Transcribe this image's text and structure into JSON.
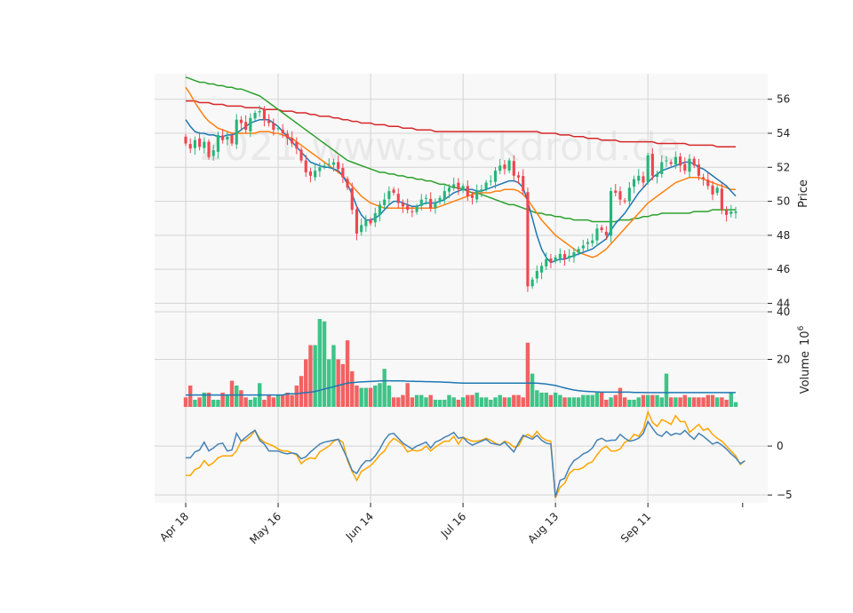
{
  "chart_data": {
    "type": "candlestick",
    "watermark": "2021 www.stockdroid.de",
    "colors": {
      "up": "#26b57a",
      "down": "#f0454f",
      "up_volume": "#3ec488",
      "down_volume": "#f26262",
      "ma_short": "#1f77b4",
      "ma_mid": "#ff7f0e",
      "ma_long": "#2ca02c",
      "ma_longest": "#d62728",
      "volume_ma": "#1f77b4",
      "macd": "#4682b4",
      "signal": "#ffa500",
      "panel_bg": "#f8f8f8",
      "grid": "#d4d4d4"
    },
    "x_tick_labels": [
      "Apr 18",
      "May 16",
      "Jun 14",
      "Jul 16",
      "Aug 13",
      "Sep 11"
    ],
    "x_tick_index": [
      0,
      20,
      40,
      60,
      80,
      100
    ],
    "n_bars": 120,
    "price": {
      "ylabel": "Price",
      "ylim": [
        43.5,
        57.5
      ],
      "yticks": [
        44,
        46,
        48,
        50,
        52,
        54,
        56
      ],
      "close": [
        53.4,
        53.1,
        53.6,
        53.2,
        53.5,
        52.6,
        53.0,
        53.9,
        53.6,
        53.8,
        53.4,
        54.8,
        54.6,
        54.2,
        54.9,
        55.2,
        55.3,
        54.8,
        54.6,
        54.2,
        54.3,
        54.0,
        53.7,
        53.4,
        53.1,
        52.4,
        51.7,
        51.5,
        51.8,
        52.0,
        52.1,
        52.2,
        52.3,
        51.9,
        51.4,
        50.8,
        49.5,
        48.1,
        48.6,
        48.9,
        48.7,
        49.3,
        49.8,
        50.1,
        50.6,
        50.5,
        49.9,
        49.7,
        49.5,
        49.4,
        49.7,
        50.1,
        50.2,
        49.6,
        49.9,
        50.2,
        50.6,
        50.8,
        51.0,
        50.7,
        50.9,
        50.3,
        50.2,
        50.6,
        50.7,
        51.1,
        51.2,
        51.8,
        52.1,
        51.9,
        52.4,
        51.5,
        51.4,
        50.6,
        45.0,
        45.4,
        45.9,
        46.2,
        46.6,
        46.4,
        46.7,
        46.9,
        46.6,
        46.8,
        47.0,
        47.2,
        47.4,
        47.6,
        47.7,
        48.4,
        48.3,
        48.0,
        50.6,
        50.5,
        50.1,
        50.0,
        50.8,
        51.3,
        51.5,
        51.1,
        52.7,
        51.5,
        51.6,
        52.3,
        52.4,
        52.2,
        52.6,
        52.1,
        51.8,
        52.5,
        52.1,
        51.5,
        51.3,
        50.9,
        50.4,
        50.8,
        49.5,
        49.2,
        49.4,
        49.4
      ],
      "ma_short": [
        54.8,
        54.4,
        54.1,
        54.0,
        54.0,
        53.9,
        53.9,
        53.8,
        53.8,
        53.9,
        53.9,
        54.0,
        54.2,
        54.4,
        54.6,
        54.7,
        54.8,
        54.8,
        54.8,
        54.6,
        54.4,
        54.1,
        53.8,
        53.5,
        53.2,
        52.9,
        52.6,
        52.3,
        52.2,
        52.1,
        52.0,
        52.0,
        51.9,
        51.8,
        51.5,
        51.0,
        50.4,
        49.7,
        49.2,
        48.9,
        48.9,
        49.0,
        49.2,
        49.5,
        49.8,
        50.0,
        50.0,
        49.9,
        49.8,
        49.7,
        49.7,
        49.8,
        49.9,
        49.9,
        49.9,
        50.0,
        50.1,
        50.3,
        50.5,
        50.6,
        50.7,
        50.7,
        50.7,
        50.6,
        50.6,
        50.7,
        50.8,
        50.9,
        51.0,
        51.1,
        51.2,
        51.2,
        51.1,
        50.8,
        50.0,
        49.0,
        48.0,
        47.2,
        46.7,
        46.4,
        46.5,
        46.6,
        46.6,
        46.7,
        46.8,
        46.9,
        47.0,
        47.1,
        47.2,
        47.4,
        47.6,
        47.8,
        48.3,
        48.7,
        49.0,
        49.3,
        49.7,
        50.1,
        50.5,
        50.8,
        51.1,
        51.4,
        51.6,
        51.8,
        51.9,
        52.0,
        52.1,
        52.2,
        52.3,
        52.3,
        52.2,
        52.0,
        51.9,
        51.7,
        51.5,
        51.3,
        51.1,
        50.9,
        50.6,
        50.3
      ],
      "ma_mid": [
        56.7,
        56.3,
        55.8,
        55.4,
        55.0,
        54.7,
        54.5,
        54.3,
        54.2,
        54.1,
        54.0,
        54.0,
        54.0,
        54.0,
        54.0,
        54.0,
        54.1,
        54.1,
        54.1,
        54.0,
        54.0,
        53.9,
        53.8,
        53.7,
        53.5,
        53.3,
        53.1,
        52.9,
        52.7,
        52.5,
        52.3,
        52.1,
        51.9,
        51.7,
        51.5,
        51.2,
        50.9,
        50.6,
        50.3,
        50.1,
        49.9,
        49.8,
        49.7,
        49.6,
        49.6,
        49.6,
        49.6,
        49.6,
        49.6,
        49.6,
        49.6,
        49.6,
        49.6,
        49.6,
        49.6,
        49.7,
        49.8,
        49.9,
        50.0,
        50.1,
        50.2,
        50.3,
        50.4,
        50.5,
        50.5,
        50.5,
        50.5,
        50.6,
        50.6,
        50.7,
        50.7,
        50.7,
        50.6,
        50.4,
        50.1,
        49.7,
        49.3,
        48.9,
        48.6,
        48.3,
        48.0,
        47.8,
        47.6,
        47.4,
        47.2,
        47.0,
        46.9,
        46.8,
        46.7,
        46.8,
        47.0,
        47.2,
        47.5,
        47.8,
        48.1,
        48.4,
        48.7,
        49.0,
        49.3,
        49.6,
        49.9,
        50.1,
        50.3,
        50.5,
        50.7,
        50.9,
        51.1,
        51.2,
        51.3,
        51.4,
        51.4,
        51.4,
        51.3,
        51.2,
        51.1,
        51.0,
        50.9,
        50.8,
        50.7,
        50.7
      ],
      "ma_long": [
        57.3,
        57.2,
        57.1,
        57.0,
        57.0,
        56.9,
        56.9,
        56.8,
        56.8,
        56.7,
        56.7,
        56.6,
        56.6,
        56.5,
        56.4,
        56.3,
        56.2,
        56.0,
        55.8,
        55.6,
        55.4,
        55.2,
        55.0,
        54.8,
        54.6,
        54.4,
        54.2,
        54.0,
        53.8,
        53.6,
        53.4,
        53.2,
        53.0,
        52.8,
        52.6,
        52.4,
        52.3,
        52.2,
        52.1,
        52.0,
        51.9,
        51.8,
        51.7,
        51.7,
        51.6,
        51.6,
        51.5,
        51.5,
        51.4,
        51.4,
        51.3,
        51.3,
        51.2,
        51.2,
        51.1,
        51.0,
        51.0,
        50.9,
        50.8,
        50.8,
        50.7,
        50.6,
        50.5,
        50.5,
        50.4,
        50.3,
        50.2,
        50.1,
        50.0,
        49.9,
        49.8,
        49.8,
        49.7,
        49.6,
        49.5,
        49.4,
        49.3,
        49.3,
        49.2,
        49.2,
        49.1,
        49.1,
        49.0,
        49.0,
        48.9,
        48.9,
        48.9,
        48.9,
        48.8,
        48.8,
        48.8,
        48.8,
        48.8,
        48.8,
        48.9,
        48.9,
        48.9,
        49.0,
        49.0,
        49.1,
        49.1,
        49.2,
        49.2,
        49.3,
        49.3,
        49.3,
        49.3,
        49.3,
        49.3,
        49.3,
        49.4,
        49.4,
        49.4,
        49.4,
        49.5,
        49.5,
        49.5,
        49.5,
        49.5,
        49.5
      ],
      "ma_longest": [
        55.9,
        55.9,
        55.9,
        55.8,
        55.8,
        55.8,
        55.7,
        55.7,
        55.7,
        55.6,
        55.6,
        55.6,
        55.6,
        55.5,
        55.5,
        55.5,
        55.5,
        55.4,
        55.4,
        55.4,
        55.4,
        55.3,
        55.3,
        55.3,
        55.2,
        55.2,
        55.2,
        55.1,
        55.1,
        55.0,
        55.0,
        55.0,
        54.9,
        54.9,
        54.8,
        54.8,
        54.7,
        54.7,
        54.6,
        54.6,
        54.6,
        54.5,
        54.5,
        54.5,
        54.4,
        54.4,
        54.4,
        54.3,
        54.3,
        54.3,
        54.2,
        54.2,
        54.2,
        54.2,
        54.1,
        54.1,
        54.1,
        54.1,
        54.1,
        54.1,
        54.1,
        54.1,
        54.1,
        54.1,
        54.1,
        54.1,
        54.1,
        54.1,
        54.1,
        54.1,
        54.1,
        54.1,
        54.1,
        54.1,
        54.1,
        54.1,
        54.1,
        54.0,
        54.0,
        54.0,
        54.0,
        53.9,
        53.9,
        53.9,
        53.8,
        53.8,
        53.8,
        53.7,
        53.7,
        53.7,
        53.6,
        53.6,
        53.6,
        53.6,
        53.5,
        53.5,
        53.5,
        53.5,
        53.5,
        53.5,
        53.5,
        53.5,
        53.4,
        53.4,
        53.4,
        53.4,
        53.4,
        53.4,
        53.4,
        53.3,
        53.3,
        53.3,
        53.3,
        53.3,
        53.3,
        53.2,
        53.2,
        53.2,
        53.2,
        53.2
      ]
    },
    "volume": {
      "ylabel": "Volume  10^6",
      "ylabel_text": "Volume",
      "ylabel_exp_base": "10",
      "ylabel_exp": "6",
      "ylim": [
        0,
        40
      ],
      "yticks": [
        20,
        40
      ],
      "values": [
        4,
        9,
        3,
        4,
        6,
        6,
        3,
        3,
        6,
        5,
        11,
        9,
        7,
        4,
        3,
        4,
        10,
        3,
        5,
        4,
        5,
        5,
        6,
        5,
        9,
        13,
        20,
        26,
        26,
        37,
        36,
        20,
        26,
        20,
        18,
        28,
        15,
        9,
        8,
        8,
        8,
        9,
        10,
        16,
        9,
        4,
        4,
        5,
        10,
        4,
        5,
        5,
        4,
        5,
        3,
        3,
        3,
        5,
        4,
        3,
        4,
        5,
        5,
        6,
        4,
        4,
        3,
        4,
        5,
        4,
        4,
        5,
        5,
        4,
        27,
        14,
        7,
        6,
        6,
        5,
        6,
        5,
        4,
        4,
        4,
        4,
        5,
        5,
        5,
        6,
        6,
        3,
        4,
        5,
        8,
        4,
        3,
        3,
        4,
        5,
        5,
        5,
        5,
        4,
        14,
        4,
        4,
        4,
        5,
        4,
        4,
        4,
        4,
        5,
        5,
        4,
        4,
        3,
        6,
        2
      ],
      "ma": [
        5,
        5,
        5,
        5,
        5,
        5,
        5,
        5,
        5,
        5,
        5,
        5,
        5,
        5,
        5,
        5,
        5,
        5,
        5,
        5,
        5,
        5,
        5.5,
        5.5,
        5.5,
        5.8,
        6.0,
        6.2,
        6.5,
        7.0,
        7.5,
        8.0,
        8.5,
        9.0,
        9.5,
        10.0,
        10.2,
        10.4,
        10.5,
        10.6,
        10.7,
        10.8,
        10.9,
        11.0,
        11.0,
        10.9,
        10.9,
        10.9,
        10.8,
        10.8,
        10.7,
        10.7,
        10.6,
        10.6,
        10.5,
        10.5,
        10.4,
        10.3,
        10.2,
        10.1,
        10.0,
        10.0,
        10.0,
        10.0,
        10.0,
        10.0,
        10.0,
        10.0,
        10.0,
        10.0,
        10.0,
        10.0,
        10.0,
        10.0,
        10.0,
        10.0,
        10.0,
        9.8,
        9.6,
        9.3,
        9.0,
        8.5,
        8.0,
        7.5,
        7.1,
        6.8,
        6.6,
        6.5,
        6.4,
        6.3,
        6.2,
        6.2,
        6.2,
        6.2,
        6.2,
        6.2,
        6.2,
        6.1,
        6.1,
        6.1,
        6.0,
        6.0,
        6.0,
        6.0,
        6.0,
        6.0,
        6.0,
        6.0,
        6.0,
        6.0,
        6.0,
        6.0,
        6.0,
        6.0,
        6.0,
        6.0,
        6.0,
        6.0,
        6.0,
        6.0
      ]
    },
    "macd": {
      "ylim": [
        -5.8,
        4.0
      ],
      "yticks": [
        -5,
        0
      ],
      "macd": [
        -1.2,
        -1.2,
        -0.6,
        -0.4,
        0.4,
        -0.5,
        -0.2,
        0.2,
        0.3,
        -0.5,
        -0.4,
        1.3,
        0.5,
        0.9,
        1.3,
        1.6,
        0.6,
        0.2,
        -0.5,
        -0.5,
        -0.5,
        -0.7,
        -0.8,
        -0.7,
        -0.8,
        -1.3,
        -1.1,
        -0.6,
        -0.2,
        0.2,
        0.4,
        0.5,
        0.6,
        0.7,
        -0.3,
        -1.3,
        -2.5,
        -2.8,
        -2.0,
        -1.5,
        -1.5,
        -1.0,
        -0.3,
        0.6,
        1.2,
        1.3,
        0.8,
        0.3,
        0.0,
        -0.3,
        0.0,
        0.2,
        0.4,
        -0.2,
        0.4,
        0.6,
        0.9,
        1.1,
        1.4,
        0.8,
        0.9,
        0.4,
        0.1,
        0.3,
        0.5,
        0.7,
        0.3,
        0.2,
        0.1,
        0.4,
        -0.1,
        -0.6,
        0.3,
        1.1,
        0.9,
        0.7,
        1.1,
        0.6,
        0.3,
        0.2,
        -5.2,
        -3.5,
        -3.3,
        -2.2,
        -1.5,
        -1.2,
        -0.8,
        -0.6,
        -0.2,
        0.6,
        0.8,
        0.5,
        0.6,
        0.6,
        1.2,
        0.8,
        0.5,
        0.6,
        0.8,
        1.3,
        2.5,
        1.8,
        1.2,
        1.0,
        1.5,
        1.1,
        1.3,
        1.2,
        1.6,
        1.1,
        0.7,
        1.3,
        1.0,
        0.6,
        0.2,
        0.4,
        0.1,
        -0.3,
        -0.8,
        -1.2,
        -1.8,
        -1.5
      ],
      "signal": [
        -3.0,
        -3.0,
        -2.4,
        -2.2,
        -1.5,
        -2.0,
        -1.7,
        -1.2,
        -1.0,
        -1.0,
        -1.0,
        -0.5,
        0.5,
        0.6,
        1.0,
        1.6,
        0.8,
        0.4,
        0.2,
        0.0,
        -0.3,
        -0.5,
        -0.5,
        -0.7,
        -0.9,
        -1.8,
        -1.4,
        -1.2,
        -1.3,
        -0.6,
        -0.3,
        0.0,
        0.5,
        0.7,
        0.4,
        -1.5,
        -2.6,
        -3.5,
        -2.6,
        -2.3,
        -2.0,
        -1.5,
        -0.9,
        -0.5,
        0.3,
        0.8,
        0.5,
        0.1,
        -0.6,
        -0.4,
        -0.5,
        -0.4,
        0.0,
        -0.5,
        -0.1,
        0.2,
        0.5,
        0.5,
        1.0,
        0.2,
        0.9,
        0.7,
        0.5,
        0.5,
        0.6,
        0.8,
        0.6,
        0.3,
        0.1,
        0.5,
        0.3,
        -0.1,
        0.0,
        0.9,
        1.2,
        0.9,
        1.5,
        0.9,
        0.6,
        0.5,
        -5.3,
        -4.2,
        -3.8,
        -2.8,
        -2.4,
        -2.4,
        -2.2,
        -1.8,
        -1.6,
        -0.9,
        -0.3,
        0.0,
        -0.5,
        -0.5,
        -0.3,
        0.4,
        0.6,
        1.2,
        1.0,
        1.7,
        3.5,
        2.4,
        2.0,
        2.7,
        2.5,
        2.2,
        3.1,
        2.5,
        2.5,
        1.4,
        1.8,
        2.2,
        1.6,
        1.8,
        1.2,
        0.8,
        0.5,
        0.0,
        -0.5,
        -1.0,
        -1.9,
        -1.5
      ]
    }
  }
}
